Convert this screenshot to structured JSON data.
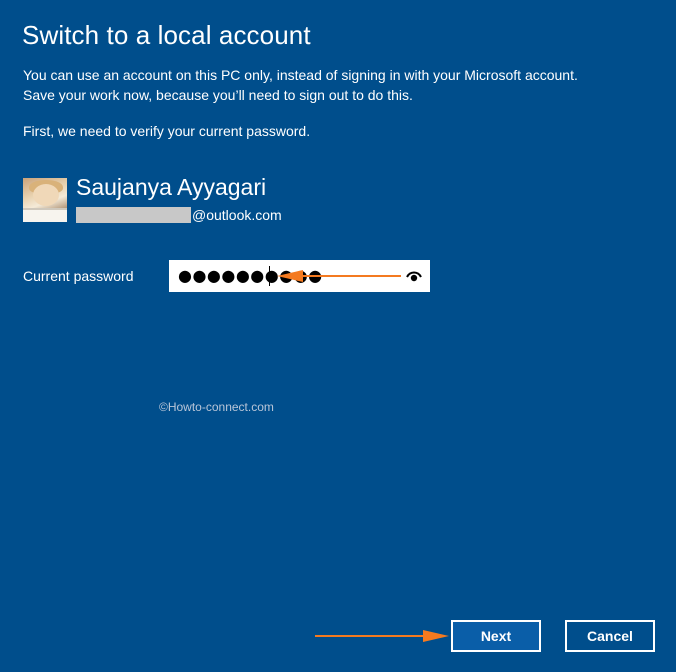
{
  "dialog": {
    "title": "Switch to a local account",
    "description_line1": "You can use an account on this PC only, instead of signing in with your Microsoft account.",
    "description_line2": "Save your work now, because you’ll need to sign out to do this.",
    "verify_text": "First, we need to verify your current password."
  },
  "user": {
    "name": "Saujanya Ayyagari",
    "email_domain": "@outlook.com"
  },
  "password": {
    "label": "Current password",
    "masked_value": "●●●●●●●●●●"
  },
  "watermark": "©Howto-connect.com",
  "buttons": {
    "next": "Next",
    "cancel": "Cancel"
  },
  "colors": {
    "background": "#004e8c",
    "annotation_arrow": "#f47a20",
    "text": "#ffffff"
  },
  "icons": {
    "reveal": "eye-icon"
  }
}
